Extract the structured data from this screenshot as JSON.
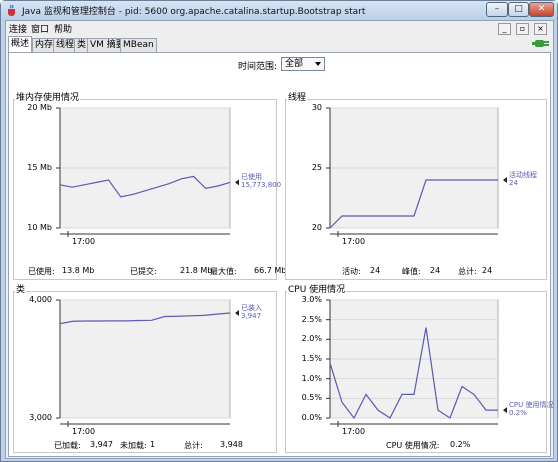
{
  "window": {
    "title": "Java 监视和管理控制台 - pid: 5600 org.apache.catalina.startup.Bootstrap start",
    "min": "–",
    "max": "□",
    "close": "✕"
  },
  "menu": [
    "连接",
    "窗口",
    "帮助"
  ],
  "tabs": [
    {
      "label": "概述",
      "active": true
    },
    {
      "label": "内存"
    },
    {
      "label": "线程"
    },
    {
      "label": "类"
    },
    {
      "label": "VM 摘要"
    },
    {
      "label": "MBean"
    }
  ],
  "inner_buttons": {
    "restore": "_",
    "max": "▫",
    "close": "×"
  },
  "time_range": {
    "label": "时间范围:",
    "value": "全部"
  },
  "icons": {
    "app": "java-cup-icon",
    "plug": "connection-plug-icon",
    "dropdown": "chevron-down-icon"
  },
  "colors": {
    "series": "#5a5ab4",
    "grid": "#d9d9d9",
    "plotbg": "#f0f0f0"
  },
  "panels": {
    "heap": {
      "title": "堆内存使用情况",
      "legend_name": "已使用",
      "legend_value": "15,773,800",
      "footer": [
        [
          "已使用:",
          "13.8",
          "Mb"
        ],
        [
          "已提交:",
          "21.8",
          "Mb"
        ],
        [
          "最大值:",
          "66.7",
          "Mb"
        ]
      ]
    },
    "threads": {
      "title": "线程",
      "legend_name": "活动线程",
      "legend_value": "24",
      "footer": [
        [
          "活动:",
          "24",
          ""
        ],
        [
          "峰值:",
          "24",
          ""
        ],
        [
          "总计:",
          "24",
          ""
        ]
      ]
    },
    "classes": {
      "title": "类",
      "legend_name": "已装入",
      "legend_value": "3,947",
      "footer": [
        [
          "已加载:",
          "3,947",
          ""
        ],
        [
          "未加载:",
          "1",
          ""
        ],
        [
          "总计:",
          "3,948",
          ""
        ]
      ]
    },
    "cpu": {
      "title": "CPU 使用情况",
      "legend_name": "CPU 使用情况",
      "legend_value": "0.2%",
      "footer": [
        [
          "CPU 使用情况:",
          "0.2%",
          ""
        ]
      ]
    }
  },
  "chart_data": [
    {
      "type": "line",
      "title": "堆内存使用情况",
      "ylim": [
        10,
        20
      ],
      "yticks": [
        "10 Mb",
        "15 Mb",
        "20 Mb"
      ],
      "xticks": [
        "17:00"
      ],
      "series": [
        {
          "name": "已使用",
          "values": [
            13.6,
            13.4,
            13.6,
            13.8,
            14.0,
            12.6,
            12.8,
            13.1,
            13.4,
            13.7,
            14.1,
            14.3,
            13.3,
            13.5,
            13.8
          ]
        }
      ]
    },
    {
      "type": "line",
      "title": "线程",
      "ylim": [
        20,
        30
      ],
      "yticks": [
        "20",
        "25",
        "30"
      ],
      "xticks": [
        "17:00"
      ],
      "series": [
        {
          "name": "活动线程",
          "values": [
            20,
            21,
            21,
            21,
            21,
            21,
            21,
            21,
            24,
            24,
            24,
            24,
            24,
            24,
            24
          ]
        }
      ]
    },
    {
      "type": "line",
      "title": "类",
      "ylim": [
        3000,
        4000
      ],
      "yticks": [
        "3,000",
        "4,000"
      ],
      "xticks": [
        "17:00"
      ],
      "series": [
        {
          "name": "已装入",
          "values": [
            3800,
            3820,
            3822,
            3822,
            3823,
            3823,
            3826,
            3828,
            3860,
            3862,
            3866,
            3870,
            3880,
            3890
          ]
        }
      ]
    },
    {
      "type": "line",
      "title": "CPU 使用情况",
      "ylim": [
        0,
        3
      ],
      "yticks": [
        "0.0%",
        "0.5%",
        "1.0%",
        "1.5%",
        "2.0%",
        "2.5%",
        "3.0%"
      ],
      "xticks": [
        "17:00"
      ],
      "series": [
        {
          "name": "CPU 使用情况",
          "values": [
            1.4,
            0.4,
            0.0,
            0.6,
            0.2,
            0.0,
            0.6,
            0.6,
            2.3,
            0.2,
            0.0,
            0.8,
            0.6,
            0.2,
            0.2
          ]
        }
      ]
    }
  ]
}
